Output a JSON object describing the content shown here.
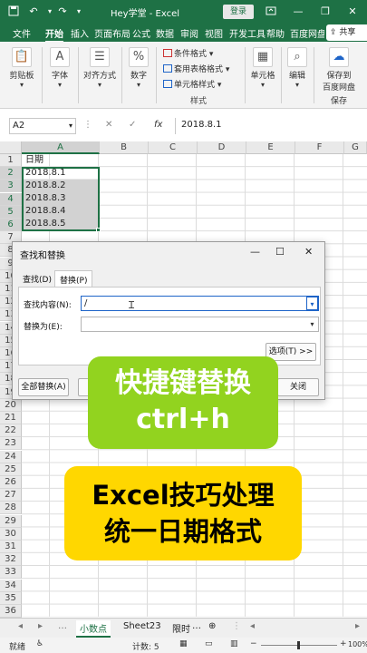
{
  "titlebar": {
    "title": "Hey学堂  -  Excel",
    "login_label": "登录",
    "save_icon": "save-icon",
    "undo_icon": "undo-icon",
    "redo_icon": "redo-icon"
  },
  "tabs": [
    "文件",
    "开始",
    "插入",
    "页面布局",
    "公式",
    "数据",
    "审阅",
    "视图",
    "开发工具",
    "帮助",
    "百度网盘"
  ],
  "active_tab": "开始",
  "share_label": "共享",
  "ribbon": {
    "clipboard": "剪贴板",
    "font": "字体",
    "align": "对齐方式",
    "number": "数字",
    "conditional": "条件格式",
    "table_format": "套用表格格式",
    "cell_style": "单元格样式",
    "styles_group": "样式",
    "cells": "单元格",
    "edit": "编辑",
    "save_to": "保存到",
    "baidu": "百度网盘",
    "save_group": "保存"
  },
  "formula_bar": {
    "name_box": "A2",
    "formula": "2018.8.1",
    "fx": "fx",
    "cancel": "✕",
    "confirm": "✓"
  },
  "grid": {
    "columns": [
      "A",
      "B",
      "C",
      "D",
      "E",
      "F",
      "G"
    ],
    "rows": [
      "1",
      "2",
      "3",
      "4",
      "5",
      "6",
      "7",
      "8",
      "9",
      "10",
      "11",
      "12",
      "13",
      "14",
      "15",
      "16",
      "17",
      "18",
      "19",
      "20",
      "21",
      "22",
      "23",
      "24",
      "25",
      "26",
      "27",
      "28",
      "29",
      "30",
      "31",
      "32",
      "33",
      "34",
      "35",
      "36"
    ],
    "cells": [
      "日期",
      "2018.8.1",
      "2018.8.2",
      "2018.8.3",
      "2018.8.4",
      "2018.8.5"
    ]
  },
  "dialog": {
    "title": "查找和替换",
    "tab_find": "查找(D)",
    "tab_replace": "替换(P)",
    "find_label": "查找内容(N):",
    "find_value": "/",
    "replace_label": "替换为(E):",
    "replace_value": "",
    "options_btn": "选项(T) >>",
    "replace_all_btn": "全部替换(A)",
    "close_btn": "关闭"
  },
  "overlays": {
    "green_line1": "快捷键替换",
    "green_line2": "ctrl+h",
    "yellow_line1": "Excel技巧处理",
    "yellow_line2": "统一日期格式"
  },
  "sheet_tabs": [
    "小数点",
    "Sheet23",
    "限时"
  ],
  "active_sheet": "小数点",
  "status": {
    "ready": "就绪",
    "count": "计数: 5",
    "zoom": "100%"
  },
  "colors": {
    "excel_green": "#1e7145",
    "banner_green": "#92d31f",
    "banner_yellow": "#ffd700"
  }
}
